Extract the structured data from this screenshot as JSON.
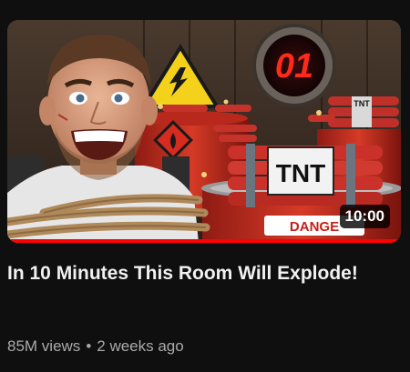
{
  "video": {
    "title": "In 10 Minutes This Room Will Explode!",
    "views": "85M views",
    "separator": "•",
    "age": "2 weeks ago",
    "duration": "10:00",
    "watch_progress": 1.0
  },
  "thumbnail": {
    "timer_display": "01",
    "tnt_label": "TNT",
    "tnt_small_label": "TNT",
    "danger_label": "DANGE"
  },
  "colors": {
    "progress": "#ff0000",
    "title": "#f1f1f1",
    "meta": "#aaaaaa",
    "background": "#0f0f0f"
  }
}
